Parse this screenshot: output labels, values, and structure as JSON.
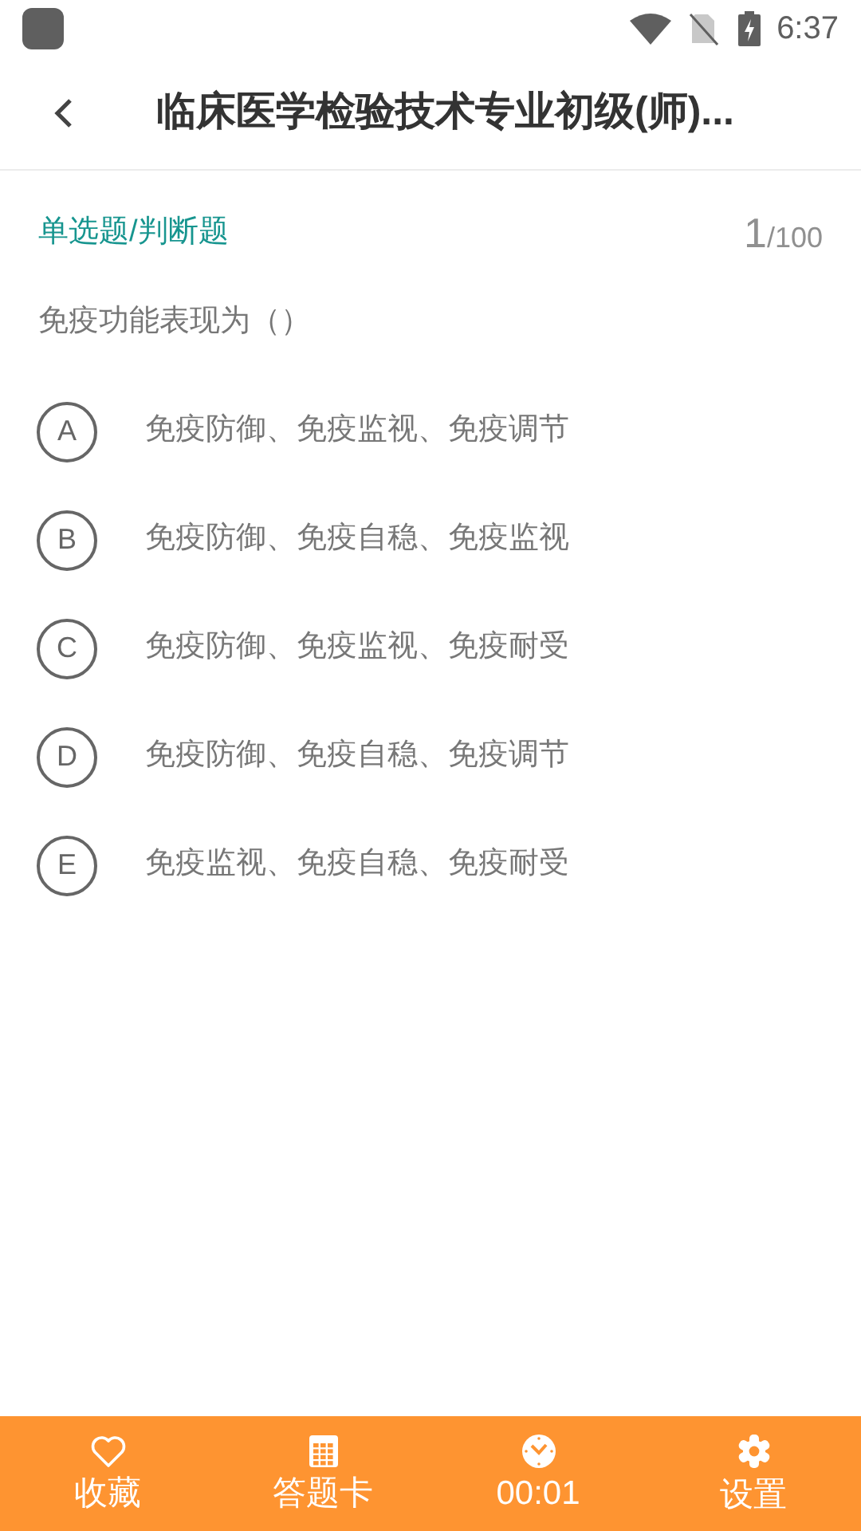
{
  "status_bar": {
    "time": "6:37"
  },
  "header": {
    "title": "临床医学检验技术专业初级(师)..."
  },
  "question": {
    "type_label": "单选题/判断题",
    "current": "1",
    "total": "/100",
    "text": "免疫功能表现为（）",
    "options": [
      {
        "letter": "A",
        "text": "免疫防御、免疫监视、免疫调节",
        "selected": false
      },
      {
        "letter": "B",
        "text": "免疫防御、免疫自稳、免疫监视",
        "selected": false
      },
      {
        "letter": "C",
        "text": "免疫防御、免疫监视、免疫耐受",
        "selected": false
      },
      {
        "letter": "D",
        "text": "免疫防御、免疫自稳、免疫调节",
        "selected": false
      },
      {
        "letter": "E",
        "text": "免疫监视、免疫自稳、免疫耐受",
        "selected": false
      }
    ]
  },
  "bottom_bar": [
    {
      "kind": "favorite",
      "label": "收藏"
    },
    {
      "kind": "card",
      "label": "答题卡"
    },
    {
      "kind": "timer",
      "label": "00:01"
    },
    {
      "kind": "settings",
      "label": "设置"
    }
  ]
}
